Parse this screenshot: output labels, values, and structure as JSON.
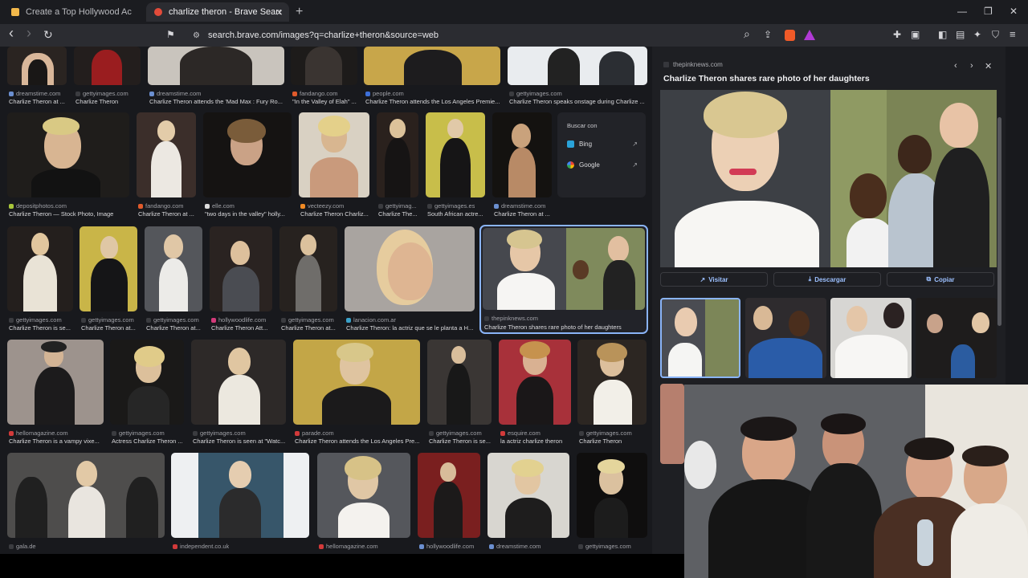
{
  "tabs": [
    {
      "title": "Create a Top Hollywood Actress Tier"
    },
    {
      "title": "charlize theron - Brave Search",
      "close": "×"
    }
  ],
  "new_tab": "+",
  "window_controls": {
    "minimize": "—",
    "maximize": "❐",
    "close": "✕"
  },
  "toolbar": {
    "back": "‹",
    "forward": "›",
    "reload": "↻",
    "bookmark": "⚑",
    "url": "search.brave.com/images?q=charlize+theron&source=web",
    "zoom": "⌕",
    "share": "⇪"
  },
  "icons": {
    "tab_favicon": "generic-page-icon",
    "active_favicon": "brave-search-icon",
    "lock": "tune-icon",
    "brave_shield": "brave-shield-icon",
    "brave_rewards": "rewards-triangle-icon",
    "extensions": "puzzle-icon",
    "wallet": "wallet-icon",
    "sidebar": "sidebar-icon",
    "leo": "leo-ai-icon",
    "vpn": "shield-icon",
    "menu": "hamburger-menu-icon"
  },
  "colors": {
    "chrome_dark": "#1b1c20",
    "toolbar": "#2b2c31",
    "content_bg": "#18191d",
    "panel_bg": "#1e1f23",
    "link_blue": "#9cc0ff",
    "selected_outline": "#8ab4f8"
  },
  "image_rows": [
    [
      {
        "source": "dreamstime.com",
        "title": "Charlize Theron at ..."
      },
      {
        "source": "gettyimages.com",
        "title": "Charlize Theron"
      },
      {
        "source": "dreamstime.com",
        "title": "Charlize Theron attends the 'Mad Max : Fury Ro..."
      },
      {
        "source": "fandango.com",
        "title": "\"In the Valley of Elah\" ..."
      },
      {
        "source": "people.com",
        "title": "Charlize Theron attends the Los Angeles Premie..."
      },
      {
        "source": "gettyimages.com",
        "title": "Charlize Theron speaks onstage during Charlize ..."
      }
    ],
    [
      {
        "source": "depositphotos.com",
        "title": "Charlize Theron — Stock Photo, Image"
      },
      {
        "source": "fandango.com",
        "title": "Charlize Theron at ..."
      },
      {
        "source": "elle.com",
        "title": "\"two days in the valley\" holly..."
      },
      {
        "source": "vecteezy.com",
        "title": "Charlize Theron Charliz..."
      },
      {
        "source": "gettyimag...",
        "title": "Charlize The..."
      },
      {
        "source": "gettyimages.es",
        "title": "South African actre..."
      },
      {
        "source": "dreamstime.com",
        "title": "Charlize Theron at ..."
      }
    ],
    [
      {
        "source": "gettyimages.com",
        "title": "Charlize Theron is se..."
      },
      {
        "source": "gettyimages.com",
        "title": "Charlize Theron at..."
      },
      {
        "source": "gettyimages.com",
        "title": "Charlize Theron at..."
      },
      {
        "source": "hollywoodlife.com",
        "title": "Charlize Theron Att..."
      },
      {
        "source": "gettyimages.com",
        "title": "Charlize Theron at..."
      },
      {
        "source": "lanacion.com.ar",
        "title": "Charlize Theron: la actriz que se le planta a H..."
      },
      {
        "source": "thepinknews.com",
        "title": "Charlize Theron shares rare photo of her daughters"
      }
    ],
    [
      {
        "source": "hellomagazine.com",
        "title": "Charlize Theron is a vampy vixe..."
      },
      {
        "source": "gettyimages.com",
        "title": "Actress Charlize Theron ..."
      },
      {
        "source": "gettyimages.com",
        "title": "Charlize Theron is seen at \"Watc..."
      },
      {
        "source": "parade.com",
        "title": "Charlize Theron attends the Los Angeles Pre..."
      },
      {
        "source": "gettyimages.com",
        "title": "Charlize Theron is se..."
      },
      {
        "source": "esquire.com",
        "title": "la actriz charlize theron"
      },
      {
        "source": "gettyimages.com",
        "title": "Charlize Theron"
      }
    ],
    [
      {
        "source": "gala.de",
        "title": ""
      },
      {
        "source": "independent.co.uk",
        "title": ""
      },
      {
        "source": "hellomagazine.com",
        "title": ""
      },
      {
        "source": "hollywoodlife.com",
        "title": ""
      },
      {
        "source": "dreamstime.com",
        "title": ""
      },
      {
        "source": "gettyimages.com",
        "title": ""
      }
    ]
  ],
  "search_with": {
    "title": "Buscar con",
    "options": [
      {
        "label": "Bing",
        "icon": "bing-icon"
      },
      {
        "label": "Google",
        "icon": "google-icon"
      }
    ],
    "share_icon": "↗"
  },
  "preview": {
    "source": "thepinknews.com",
    "title": "Charlize Theron shares rare photo of her daughters",
    "prev": "‹",
    "next": "›",
    "close": "✕",
    "actions": [
      {
        "label": "Visitar",
        "icon": "↗"
      },
      {
        "label": "Descargar",
        "icon": "⤓"
      },
      {
        "label": "Copiar",
        "icon": "⧉"
      }
    ]
  }
}
